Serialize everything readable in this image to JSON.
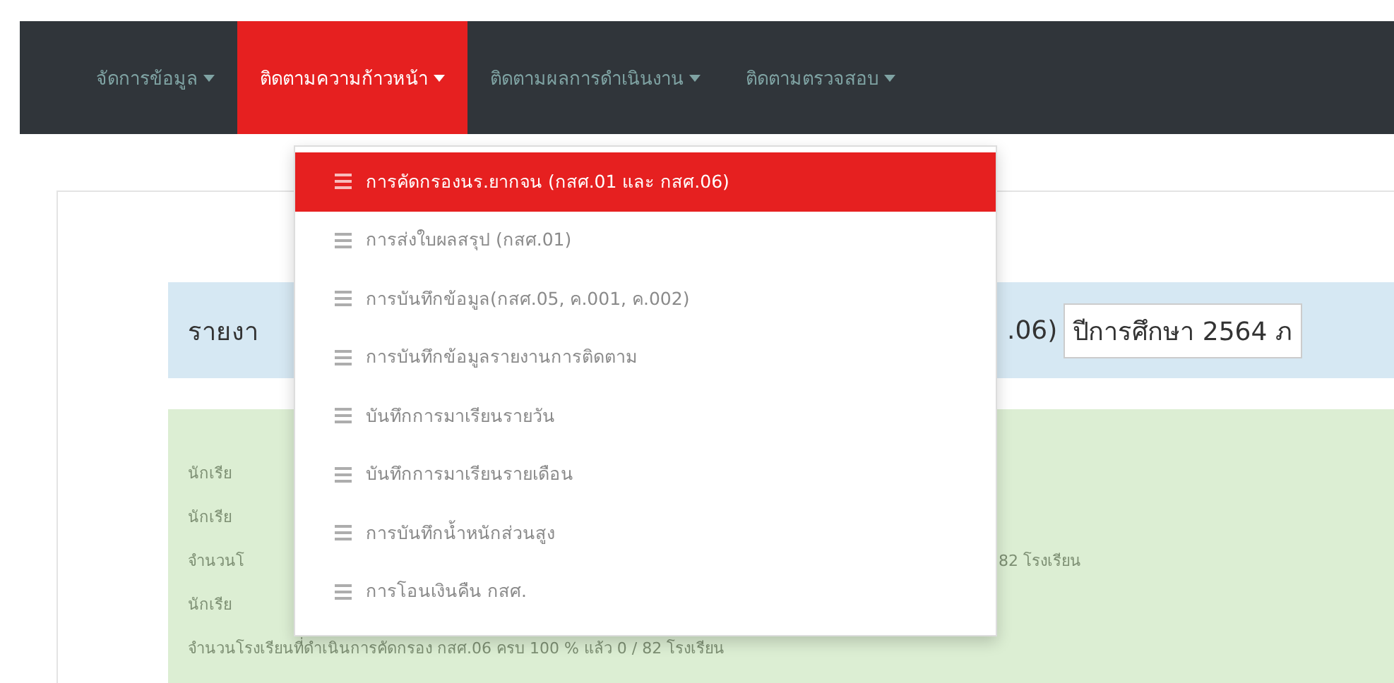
{
  "navbar": {
    "items": [
      {
        "label": "จัดการข้อมูล",
        "selected": false
      },
      {
        "label": "ติดตามความก้าวหน้า",
        "selected": true
      },
      {
        "label": "ติดตามผลการดำเนินงาน",
        "selected": false
      },
      {
        "label": "ติดตามตรวจสอบ",
        "selected": false
      }
    ]
  },
  "dropdown": {
    "items": [
      {
        "label": "การคัดกรองนร.ยากจน (กสศ.01 และ กสศ.06)",
        "selected": true
      },
      {
        "label": "การส่งใบผลสรุป (กสศ.01)",
        "selected": false
      },
      {
        "label": "การบันทึกข้อมูล(กสศ.05, ค.001, ค.002)",
        "selected": false
      },
      {
        "label": "การบันทึกข้อมูลรายงานการติดตาม",
        "selected": false
      },
      {
        "label": "บันทึกการมาเรียนรายวัน",
        "selected": false
      },
      {
        "label": "บันทึกการมาเรียนรายเดือน",
        "selected": false
      },
      {
        "label": "การบันทึกน้ำหนักส่วนสูง",
        "selected": false
      },
      {
        "label": "การโอนเงินคืน กสศ.",
        "selected": false
      }
    ]
  },
  "report_header": {
    "title_start": "รายงา",
    "title_end": ".06)",
    "year_select": {
      "value": "ปีการศึกษา 2564 ภ"
    }
  },
  "summary_lines": [
    {
      "start": "นักเรีย"
    },
    {
      "start": "นักเรีย"
    },
    {
      "start": "จำนวนโ",
      "end": "82 โรงเรียน"
    },
    {
      "start": "นักเรีย"
    },
    {
      "start": "จำนวนโรงเรียนที่ดำเนินการคัดกรอง กสศ.06 ครบ 100 % แล้ว 0 / 82 โรงเรียน"
    }
  ]
}
